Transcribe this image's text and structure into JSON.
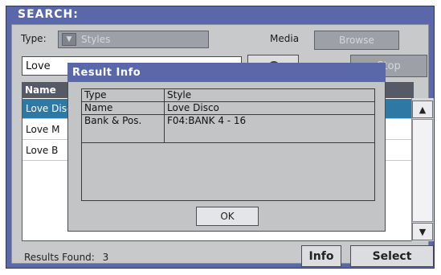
{
  "window": {
    "title": "SEARCH:"
  },
  "filters": {
    "type_label": "Type:",
    "type_value": "Styles",
    "media_label": "Media",
    "browse_label": "Browse"
  },
  "search": {
    "value": "Love",
    "stop_label": "Stop"
  },
  "list": {
    "header": "Name",
    "rows": [
      "Love Disco",
      "Love M",
      "Love B"
    ]
  },
  "footer": {
    "results_label": "Results Found:",
    "results_count": "3",
    "info_label": "Info",
    "select_label": "Select"
  },
  "dialog": {
    "title": "Result Info",
    "rows": [
      {
        "key": "Type",
        "value": "Style"
      },
      {
        "key": "Name",
        "value": "Love Disco"
      },
      {
        "key": "Bank & Pos.",
        "value": "F04:BANK 4 - 16"
      }
    ],
    "ok_label": "OK"
  }
}
